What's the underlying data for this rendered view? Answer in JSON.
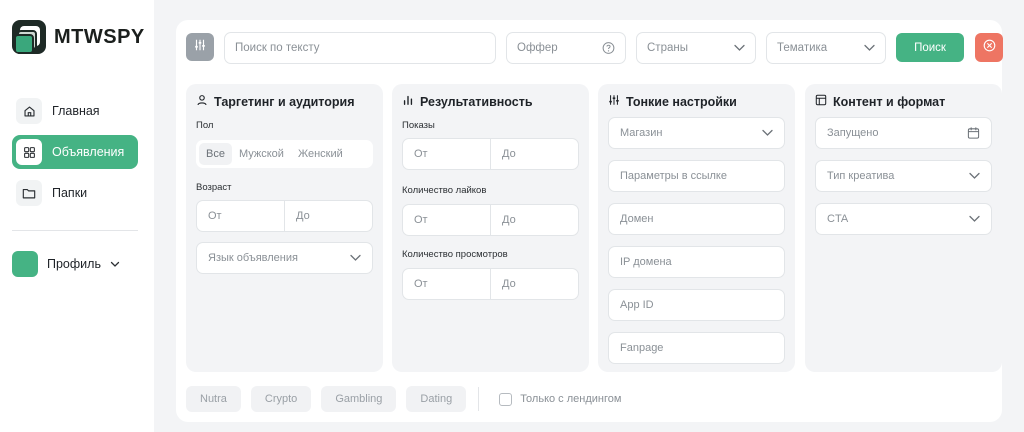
{
  "brand": {
    "name": "MTWSPY"
  },
  "nav": {
    "items": [
      {
        "label": "Главная",
        "icon": "home-icon"
      },
      {
        "label": "Объявления",
        "icon": "grid-icon",
        "active": true
      },
      {
        "label": "Папки",
        "icon": "folder-icon"
      }
    ],
    "profile": {
      "label": "Профиль"
    }
  },
  "topbar": {
    "search_placeholder": "Поиск по тексту",
    "offer_placeholder": "Оффер",
    "countries": "Страны",
    "topic": "Тематика",
    "search_button": "Поиск"
  },
  "targeting": {
    "title": "Таргетинг и аудитория",
    "gender_label": "Пол",
    "gender_options": [
      "Все",
      "Мужской",
      "Женский"
    ],
    "age_label": "Возраст",
    "from": "От",
    "to": "До",
    "language": "Язык объявления"
  },
  "performance": {
    "title": "Результативность",
    "impressions_label": "Показы",
    "likes_label": "Количество лайков",
    "views_label": "Количество просмотров",
    "from": "От",
    "to": "До"
  },
  "fine": {
    "title": "Тонкие настройки",
    "store": "Магазин",
    "link_params": "Параметры в ссылке",
    "domain": "Домен",
    "domain_ip": "IP домена",
    "app_id": "App ID",
    "fanpage": "Fanpage"
  },
  "content": {
    "title": "Контент и формат",
    "launched": "Запущено",
    "creative_type": "Тип креатива",
    "cta": "CTA"
  },
  "tags": [
    "Nutra",
    "Crypto",
    "Gambling",
    "Dating"
  ],
  "landing_only": "Только с лендингом",
  "colors": {
    "accent": "#45b384",
    "danger": "#ee7563"
  }
}
